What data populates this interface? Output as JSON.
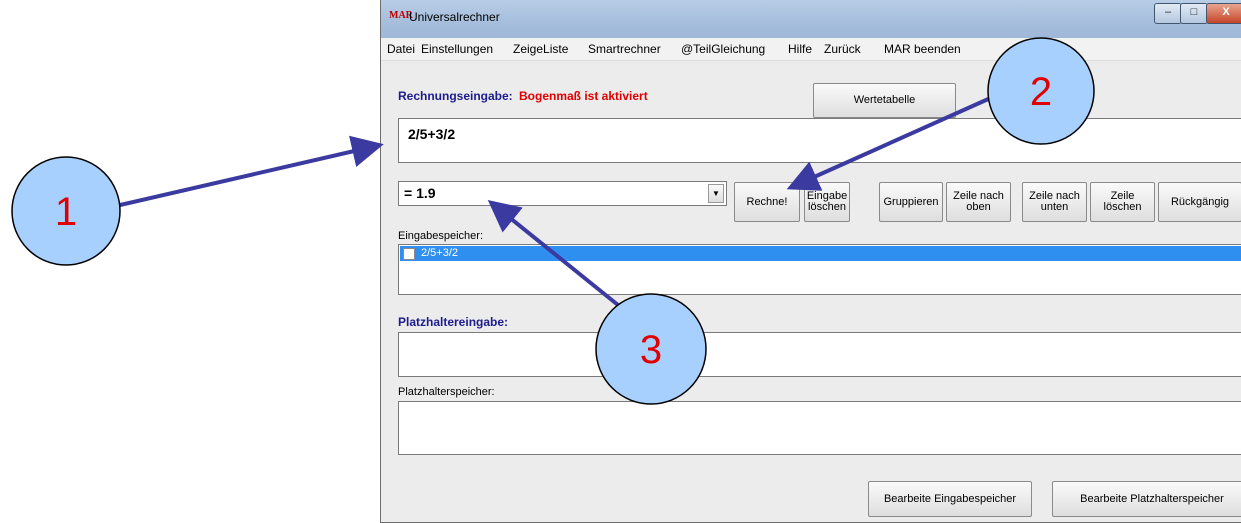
{
  "window": {
    "title": "Universalrechner",
    "logo": "MAR"
  },
  "window_controls": {
    "minimize": "–",
    "maximize": "□",
    "close": "X"
  },
  "menu": [
    "Datei",
    "Einstellungen",
    "ZeigeListe",
    "Smartrechner",
    "@TeilGleichung",
    "Hilfe",
    "Zurück",
    "MAR beenden"
  ],
  "rechnung": {
    "label": "Rechnungseingabe:",
    "status": "Bogenmaß ist aktiviert",
    "input_value": "2/5+3/2"
  },
  "wertetabelle_label": "Wertetabelle",
  "result": {
    "value": "= 1.9"
  },
  "toolbar": {
    "rechne": "Rechne!",
    "eingabe_loeschen": "Eingabe\nlöschen",
    "gruppieren": "Gruppieren",
    "zeile_oben": "Zeile nach\noben",
    "zeile_unten": "Zeile nach\nunten",
    "zeile_loeschen": "Zeile\nlöschen",
    "rueckgaengig": "Rückgängig"
  },
  "eingabespeicher": {
    "label": "Eingabespeicher:",
    "items": [
      "2/5+3/2"
    ]
  },
  "platzhalter": {
    "label": "Platzhaltereingabe:",
    "speicher_label": "Platzhalterspeicher:"
  },
  "bottom_buttons": {
    "bearbeite_eingabe": "Bearbeite Eingabespeicher",
    "bearbeite_platz": "Bearbeite Platzhalterspeicher"
  },
  "callouts": [
    "1",
    "2",
    "3"
  ],
  "colors": {
    "callout_fill": "#a8d0ff",
    "arrow": "#3a3aa0",
    "callout_text": "#e00000",
    "selection": "#2f8ff0"
  }
}
